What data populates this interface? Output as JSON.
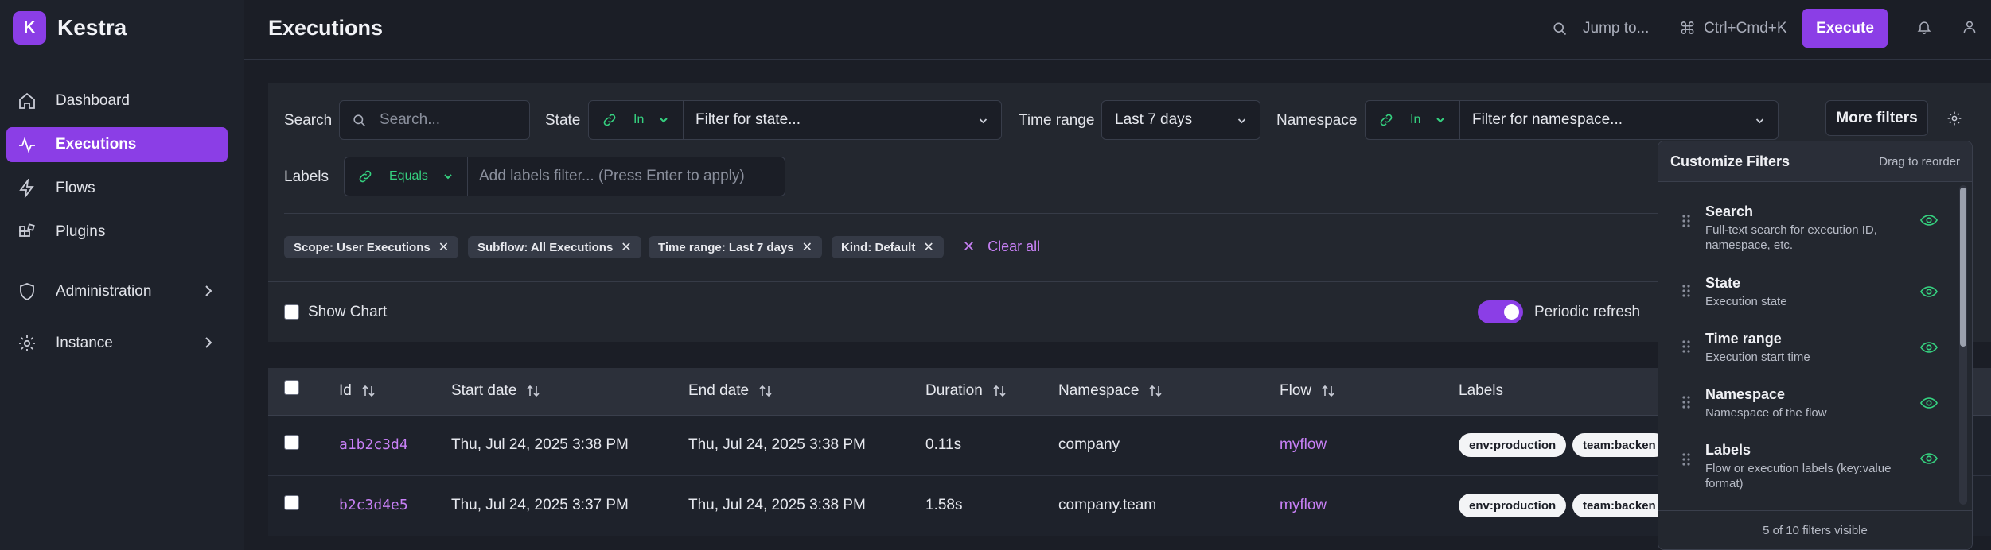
{
  "brand": {
    "logo_letter": "K",
    "name": "Kestra"
  },
  "sidebar": {
    "items": [
      {
        "label": "Dashboard",
        "icon": "home-icon"
      },
      {
        "label": "Executions",
        "icon": "activity-icon",
        "active": true
      },
      {
        "label": "Flows",
        "icon": "lightning-icon"
      },
      {
        "label": "Plugins",
        "icon": "plugins-icon"
      },
      {
        "label": "Administration",
        "icon": "shield-icon",
        "expandable": true
      },
      {
        "label": "Instance",
        "icon": "gear-icon",
        "expandable": true
      }
    ]
  },
  "header": {
    "title": "Executions",
    "jump_to": "Jump to...",
    "shortcut": "Ctrl+Cmd+K",
    "execute_label": "Execute"
  },
  "filters": {
    "search_label": "Search",
    "search_placeholder": "Search...",
    "state_label": "State",
    "state_operator": "In",
    "state_placeholder": "Filter for state...",
    "time_range_label": "Time range",
    "time_range_value": "Last 7 days",
    "namespace_label": "Namespace",
    "namespace_operator": "In",
    "namespace_placeholder": "Filter for namespace...",
    "more_filters_label": "More filters",
    "labels_label": "Labels",
    "labels_operator": "Equals",
    "labels_placeholder": "Add labels filter... (Press Enter to apply)",
    "chips": [
      "Scope: User Executions",
      "Subflow: All Executions",
      "Time range: Last 7 days",
      "Kind: Default"
    ],
    "clear_all_label": "Clear all",
    "show_chart_label": "Show Chart",
    "periodic_refresh_label": "Periodic refresh",
    "periodic_refresh_on": true
  },
  "table": {
    "columns": [
      "Id",
      "Start date",
      "End date",
      "Duration",
      "Namespace",
      "Flow",
      "Labels"
    ],
    "rows": [
      {
        "id": "a1b2c3d4",
        "start": "Thu, Jul 24, 2025 3:38 PM",
        "end": "Thu, Jul 24, 2025 3:38 PM",
        "duration": "0.11s",
        "namespace": "company",
        "flow": "myflow",
        "labels": [
          "env:production",
          "team:backen"
        ]
      },
      {
        "id": "b2c3d4e5",
        "start": "Thu, Jul 24, 2025 3:37 PM",
        "end": "Thu, Jul 24, 2025 3:38 PM",
        "duration": "1.58s",
        "namespace": "company.team",
        "flow": "myflow",
        "labels": [
          "env:production",
          "team:backen"
        ]
      }
    ]
  },
  "customize": {
    "title": "Customize Filters",
    "hint": "Drag to reorder",
    "items": [
      {
        "title": "Search",
        "desc": "Full-text search for execution ID, namespace, etc."
      },
      {
        "title": "State",
        "desc": "Execution state"
      },
      {
        "title": "Time range",
        "desc": "Execution start time"
      },
      {
        "title": "Namespace",
        "desc": "Namespace of the flow"
      },
      {
        "title": "Labels",
        "desc": "Flow or execution labels (key:value format)"
      }
    ],
    "footer": "5 of 10 filters visible"
  },
  "colors": {
    "accent": "#8b3ee6",
    "link": "#c780f5",
    "green": "#35d07f",
    "background": "#1b1e26"
  }
}
